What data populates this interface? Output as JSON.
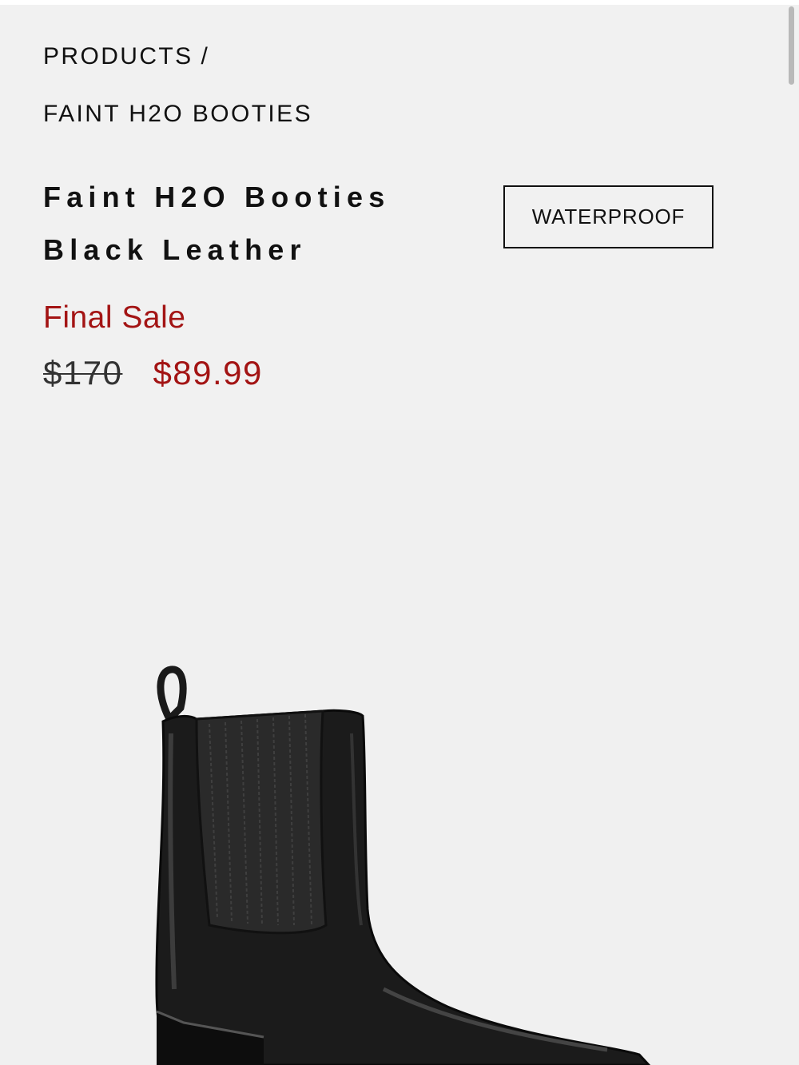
{
  "breadcrumb": {
    "root": "PRODUCTS",
    "separator": "/",
    "current": "FAINT H2O BOOTIES"
  },
  "product": {
    "title_line1": "Faint H2O Booties",
    "title_line2": "Black Leather",
    "badge": "WATERPROOF",
    "sale_label": "Final Sale",
    "original_price": "$170",
    "sale_price": "$89.99",
    "image_icon": "ankle-boot-image"
  },
  "colors": {
    "sale_red": "#a31414",
    "background": "#f1f1f1",
    "text": "#111111"
  }
}
